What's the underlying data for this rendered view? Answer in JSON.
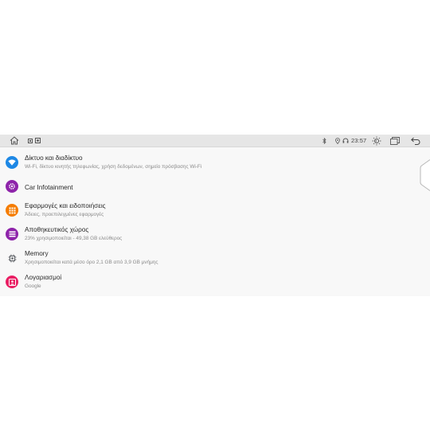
{
  "status_bar": {
    "time": "23:57",
    "icons": [
      "home-icon",
      "notification-icon",
      "media-icon",
      "bluetooth-icon",
      "location-icon",
      "headset-icon",
      "brightness-icon",
      "recent-apps-icon",
      "back-icon"
    ]
  },
  "settings": [
    {
      "title": "Δίκτυο και διαδίκτυο",
      "subtitle": "Wi-Fi, δίκτυο κινητής τηλεφωνίας, χρήση δεδομένων, σημείο πρόσβασης Wi-Fi",
      "icon": "wifi-icon",
      "color": "#1e88e5"
    },
    {
      "title": "Car Infotainment",
      "subtitle": "",
      "icon": "car-settings-icon",
      "color": "#8e24aa"
    },
    {
      "title": "Εφαρμογές και ειδοποιήσεις",
      "subtitle": "Άδειες, προεπιλεγμένες εφαρμογές",
      "icon": "apps-icon",
      "color": "#f57c00"
    },
    {
      "title": "Αποθηκευτικός χώρος",
      "subtitle": "23% χρησιμοποιείται - 49,38 GB ελεύθερος",
      "icon": "storage-icon",
      "color": "#8e24aa"
    },
    {
      "title": "Memory",
      "subtitle": "Χρησιμοποιείται κατά μέσο όρο 2,1 GB από 3,9 GB μνήμης",
      "icon": "memory-icon",
      "color": "#5f6368"
    },
    {
      "title": "Λογαριασμοί",
      "subtitle": "Google",
      "icon": "account-icon",
      "color": "#e91e63"
    }
  ]
}
